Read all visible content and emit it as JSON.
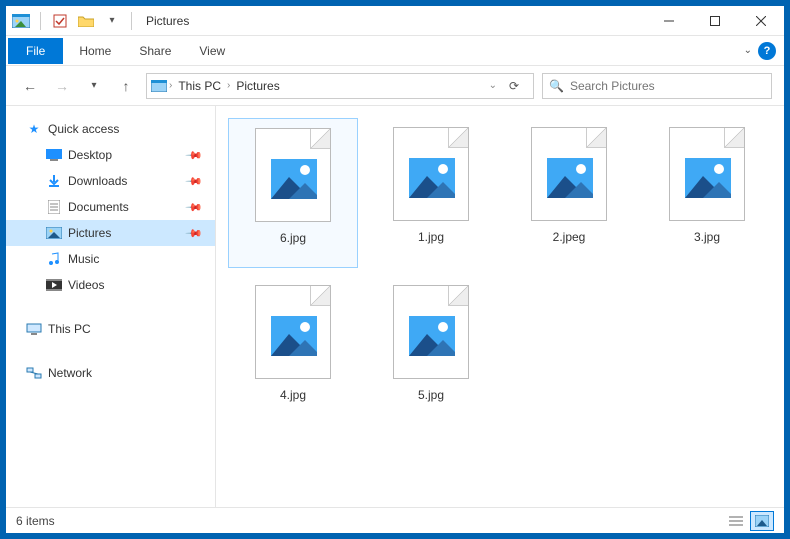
{
  "window": {
    "title": "Pictures"
  },
  "ribbon": {
    "file_label": "File",
    "tabs": [
      "Home",
      "Share",
      "View"
    ]
  },
  "breadcrumb": {
    "parts": [
      "This PC",
      "Pictures"
    ]
  },
  "search": {
    "placeholder": "Search Pictures"
  },
  "sidebar": {
    "quick_access": {
      "label": "Quick access",
      "items": [
        {
          "label": "Desktop",
          "pinned": true,
          "icon": "desktop"
        },
        {
          "label": "Downloads",
          "pinned": true,
          "icon": "downloads"
        },
        {
          "label": "Documents",
          "pinned": true,
          "icon": "documents"
        },
        {
          "label": "Pictures",
          "pinned": true,
          "icon": "pictures",
          "selected": true
        },
        {
          "label": "Music",
          "pinned": false,
          "icon": "music"
        },
        {
          "label": "Videos",
          "pinned": false,
          "icon": "videos"
        }
      ]
    },
    "this_pc": {
      "label": "This PC"
    },
    "network": {
      "label": "Network"
    }
  },
  "files": [
    {
      "name": "6.jpg",
      "selected": true
    },
    {
      "name": "1.jpg"
    },
    {
      "name": "2.jpeg"
    },
    {
      "name": "3.jpg"
    },
    {
      "name": "4.jpg"
    },
    {
      "name": "5.jpg"
    }
  ],
  "status": {
    "count_label": "6 items"
  }
}
